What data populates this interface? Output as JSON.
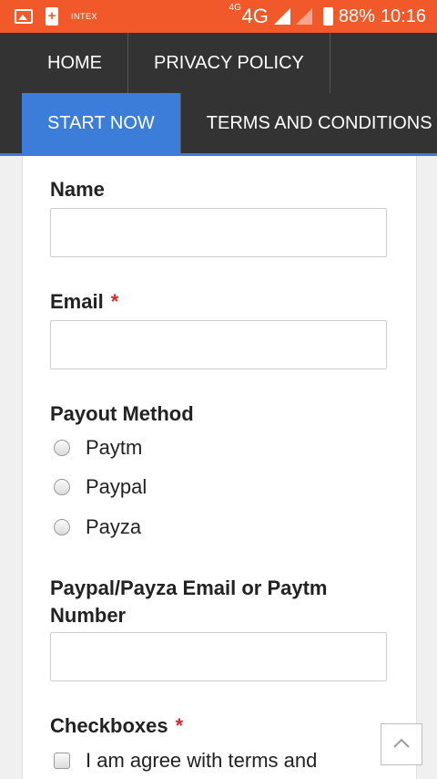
{
  "status_bar": {
    "brand": "INTEX",
    "network_type": "4G",
    "network_superscript": "4G",
    "battery_percent": "88%",
    "time": "10:16",
    "icons": [
      "image-icon",
      "battery-saver-icon",
      "signal-icon",
      "signal-empty-icon",
      "battery-icon"
    ]
  },
  "nav": {
    "items": [
      {
        "label": "HOME"
      },
      {
        "label": "PRIVACY POLICY"
      },
      {
        "label": "START NOW",
        "active": true
      },
      {
        "label": "TERMS AND CONDITIONS"
      }
    ]
  },
  "form": {
    "name_label": "Name",
    "email_label": "Email",
    "required_mark": "*",
    "payout_label": "Payout Method",
    "payout_options": [
      "Paytm",
      "Paypal",
      "Payza"
    ],
    "account_label_line1": "Paypal/Payza Email or Paytm",
    "account_label_line2": "Number",
    "checkboxes_label": "Checkboxes",
    "checkbox_text": "I am agree with terms and"
  },
  "colors": {
    "status_bar": "#f1592a",
    "nav_bg": "#333333",
    "active_tab": "#3b7dd8",
    "required": "#d9262d"
  }
}
